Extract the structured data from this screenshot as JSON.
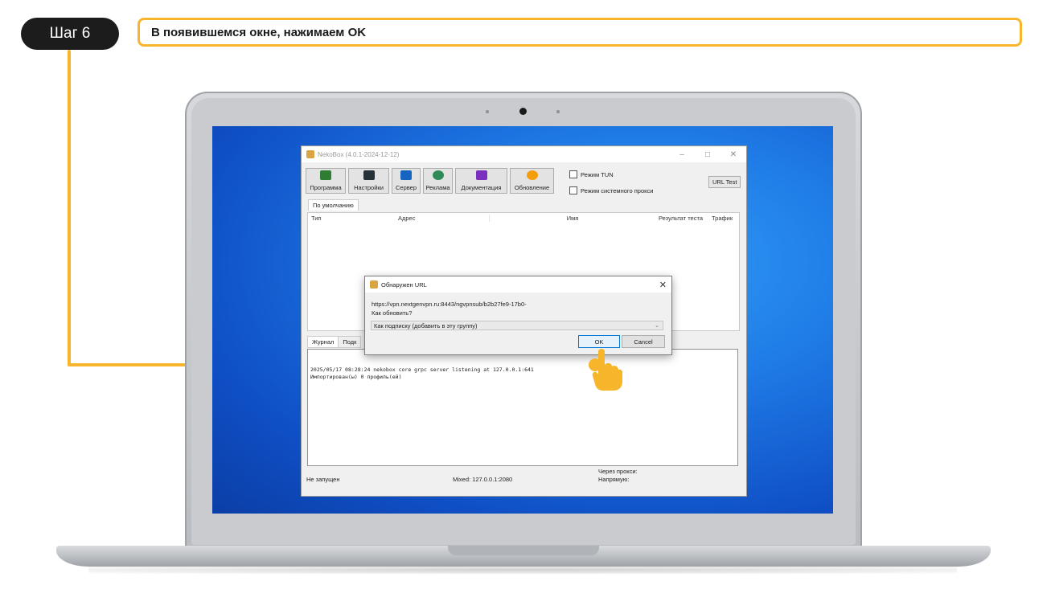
{
  "step": {
    "label": "Шаг 6",
    "instruction": "В появившемся окне, нажимаем OK"
  },
  "app": {
    "title": "NekoBox (4.0.1-2024-12-12)",
    "toolbar": [
      {
        "label": "Программа",
        "icon": "program-icon",
        "color": "#2e7d32"
      },
      {
        "label": "Настройки",
        "icon": "settings-icon",
        "color": "#263238"
      },
      {
        "label": "Сервер",
        "icon": "server-icon",
        "color": "#1565c0"
      },
      {
        "label": "Реклама",
        "icon": "globe-icon",
        "color": "#2e8b57"
      },
      {
        "label": "Документация",
        "icon": "docs-icon",
        "color": "#7b2fbe"
      },
      {
        "label": "Обновление",
        "icon": "update-icon",
        "color": "#f59e0b"
      }
    ],
    "checkboxes": {
      "tun": "Режим TUN",
      "system_proxy": "Режим системного прокси"
    },
    "url_test": "URL Test",
    "group_tab": "По умолчанию",
    "columns": {
      "type": "Тип",
      "address": "Адрес",
      "name": "Имя",
      "test_result": "Результат теста",
      "traffic": "Трафик"
    },
    "log_tabs": {
      "journal": "Журнал",
      "second": "Подк"
    },
    "log_lines": [
      "2025/05/17 08:28:24 nekobox core grpc server listening at 127.0.0.1:641",
      "Импортирован(ы) 0 профиль(ей)"
    ],
    "status": {
      "state": "Не запущен",
      "mixed": "Mixed: 127.0.0.1:2080",
      "via_proxy": "Через прокси:",
      "direct": "Напрямую:"
    }
  },
  "dialog": {
    "title": "Обнаружен URL",
    "url": "https://vpn.nextgenvpn.ru:8443/ngvpnsub/b2b27fe9-17b0-",
    "question": "Как обновить?",
    "selected_option": "Как подписку (добавить в эту группу)",
    "ok_label": "OK",
    "cancel_label": "Cancel"
  },
  "colors": {
    "accent": "#f7b52c",
    "pill": "#1c1c1c",
    "desktop": "#1f7be6"
  }
}
